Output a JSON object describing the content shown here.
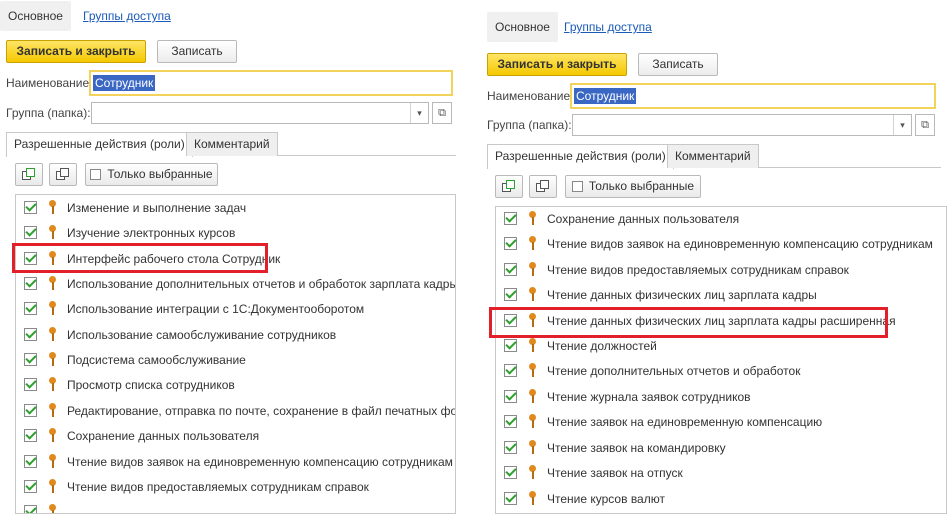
{
  "left": {
    "nav": {
      "main_tab": "Основное",
      "access_link": "Группы доступа"
    },
    "toolbar": {
      "save_close": "Записать и закрыть",
      "save": "Записать"
    },
    "name_label": "Наименование:",
    "name_value": "Сотрудник",
    "group_label": "Группа (папка):",
    "tabs": {
      "roles": "Разрешенные действия (роли)",
      "comment": "Комментарий"
    },
    "list_toolbar": {
      "only_selected": "Только выбранные"
    },
    "roles": [
      "Изменение и выполнение задач",
      "Изучение электронных курсов",
      "Интерфейс рабочего стола Сотрудник",
      "Использование дополнительных отчетов и обработок зарплата кадры",
      "Использование интеграции с 1С:Документооборотом",
      "Использование самообслуживание сотрудников",
      "Подсистема самообслуживание",
      "Просмотр списка сотрудников",
      "Редактирование, отправка по почте, сохранение в файл печатных форм",
      "Сохранение данных пользователя",
      "Чтение видов заявок на единовременную компенсацию сотрудникам",
      "Чтение видов предоставляемых сотрудникам справок",
      ""
    ]
  },
  "right": {
    "nav": {
      "main_tab": "Основное",
      "access_link": "Группы доступа"
    },
    "toolbar": {
      "save_close": "Записать и закрыть",
      "save": "Записать"
    },
    "name_label": "Наименование:",
    "name_value": "Сотрудник",
    "group_label": "Группа (папка):",
    "tabs": {
      "roles": "Разрешенные действия (роли)",
      "comment": "Комментарий"
    },
    "list_toolbar": {
      "only_selected": "Только выбранные"
    },
    "roles": [
      "Сохранение данных пользователя",
      "Чтение видов заявок на единовременную компенсацию сотрудникам",
      "Чтение видов предоставляемых сотрудникам справок",
      "Чтение данных физических лиц зарплата кадры",
      "Чтение данных физических лиц зарплата кадры расширенная",
      "Чтение должностей",
      "Чтение дополнительных отчетов и обработок",
      "Чтение журнала заявок сотрудников",
      "Чтение заявок на единовременную компенсацию",
      "Чтение заявок на командировку",
      "Чтение заявок на отпуск",
      "Чтение курсов валют"
    ]
  },
  "colors": {
    "primary_button": "#f4c800",
    "highlight": "#e3202a",
    "link": "#1a5ab8",
    "check": "#2ea02e",
    "key": "#e08a1e"
  },
  "icons": [
    "checkbox-checked-icon",
    "key-icon",
    "check-all-icon",
    "copy-icon",
    "dropdown-arrow-icon",
    "open-icon"
  ]
}
